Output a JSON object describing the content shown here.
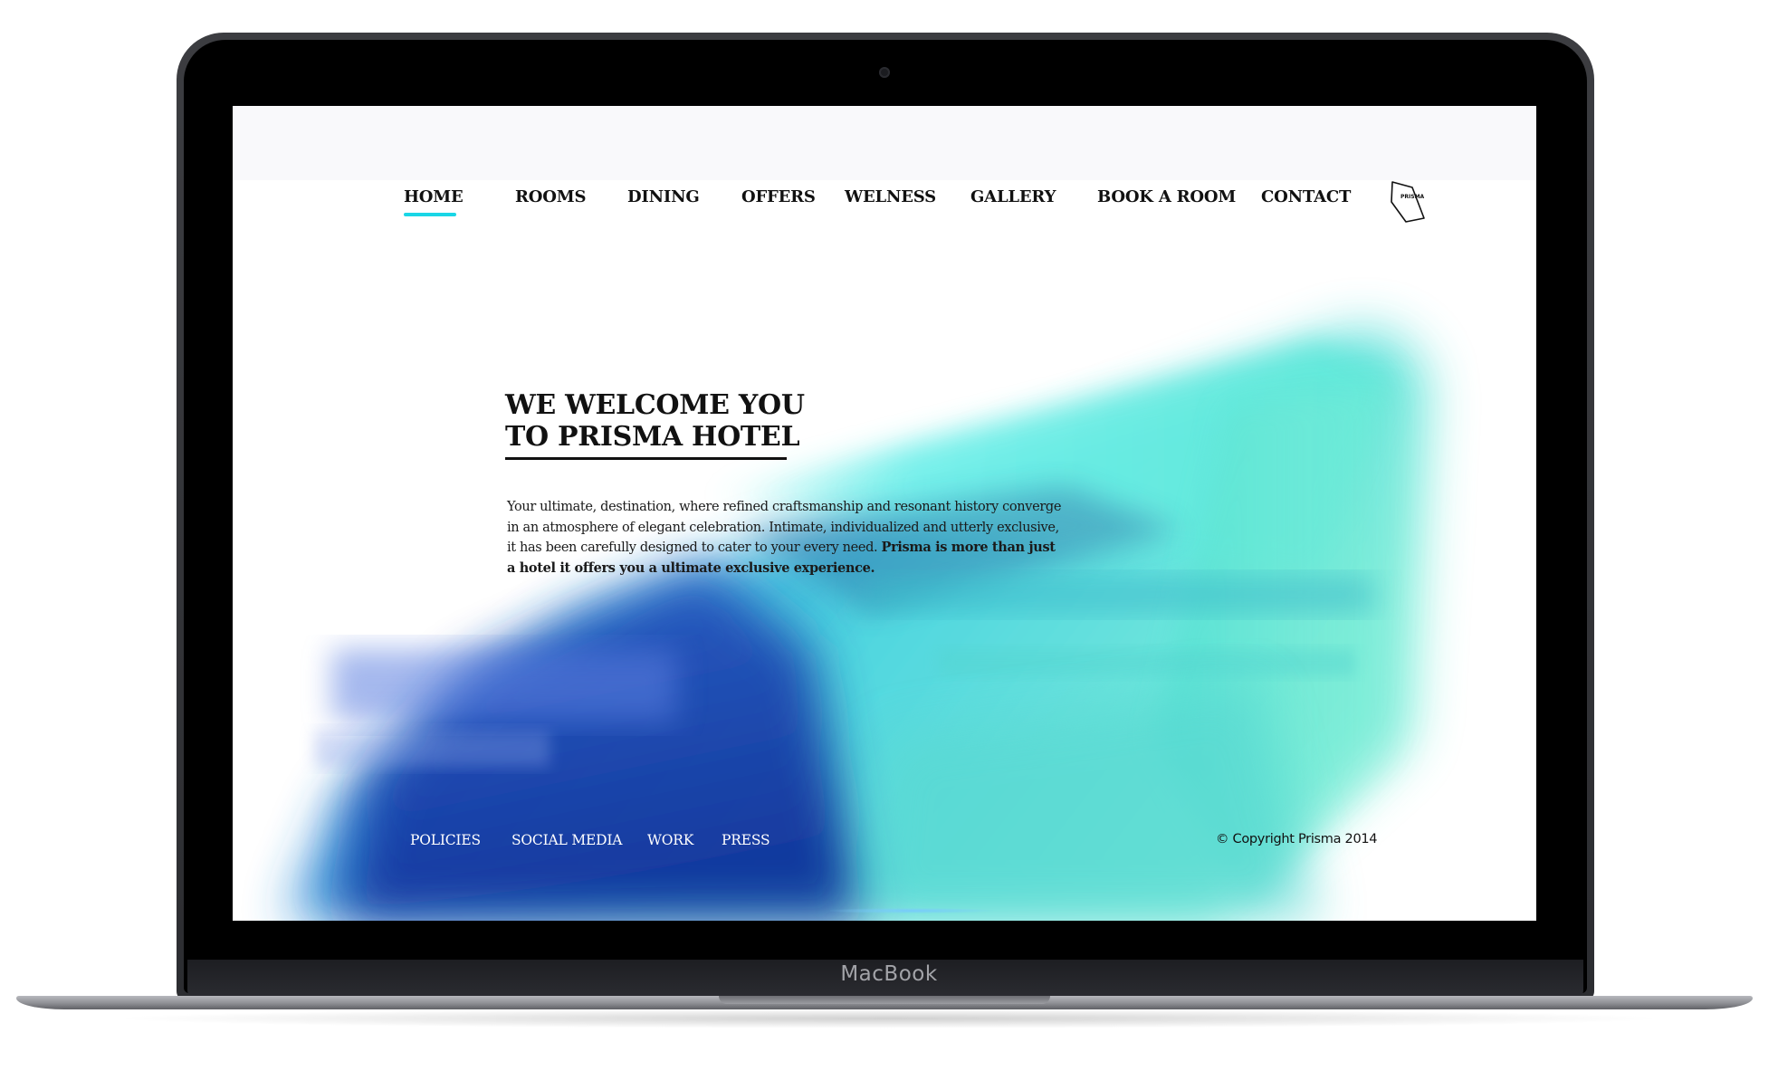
{
  "device": {
    "brand_label": "MacBook"
  },
  "nav": {
    "items": [
      {
        "label": "HOME",
        "active": true
      },
      {
        "label": "ROOMS",
        "active": false
      },
      {
        "label": "DINING",
        "active": false
      },
      {
        "label": "OFFERS",
        "active": false
      },
      {
        "label": "WELNESS",
        "active": false
      },
      {
        "label": "GALLERY",
        "active": false
      },
      {
        "label": "BOOK A ROOM",
        "active": false
      },
      {
        "label": "CONTACT",
        "active": false
      }
    ],
    "logo_text": "PRISMA",
    "active_indicator_color": "#19d6e6"
  },
  "hero": {
    "title_line1": "WE WELCOME YOU",
    "title_line2": "TO PRISMA HOTEL",
    "body_line1": "Your ultimate, destination, where refined craftsmanship and resonant history converge",
    "body_line2": "in an atmosphere of elegant celebration. Intimate, individualized and utterly exclusive,",
    "body_line3_regular": "it has been carefully designed to cater to your every need. ",
    "body_line3_bold": "Prisma is more than just",
    "body_line4_bold": "a hotel it offers you a ultimate exclusive experience."
  },
  "footer": {
    "links": [
      "POLICIES",
      "SOCIAL MEDIA",
      "WORK",
      "PRESS"
    ],
    "copyright": "© Copyright Prisma 2014"
  },
  "colors": {
    "accent": "#19d6e6",
    "graphic_cyan": "#5fe8dc",
    "graphic_blue": "#1d3f9e"
  }
}
